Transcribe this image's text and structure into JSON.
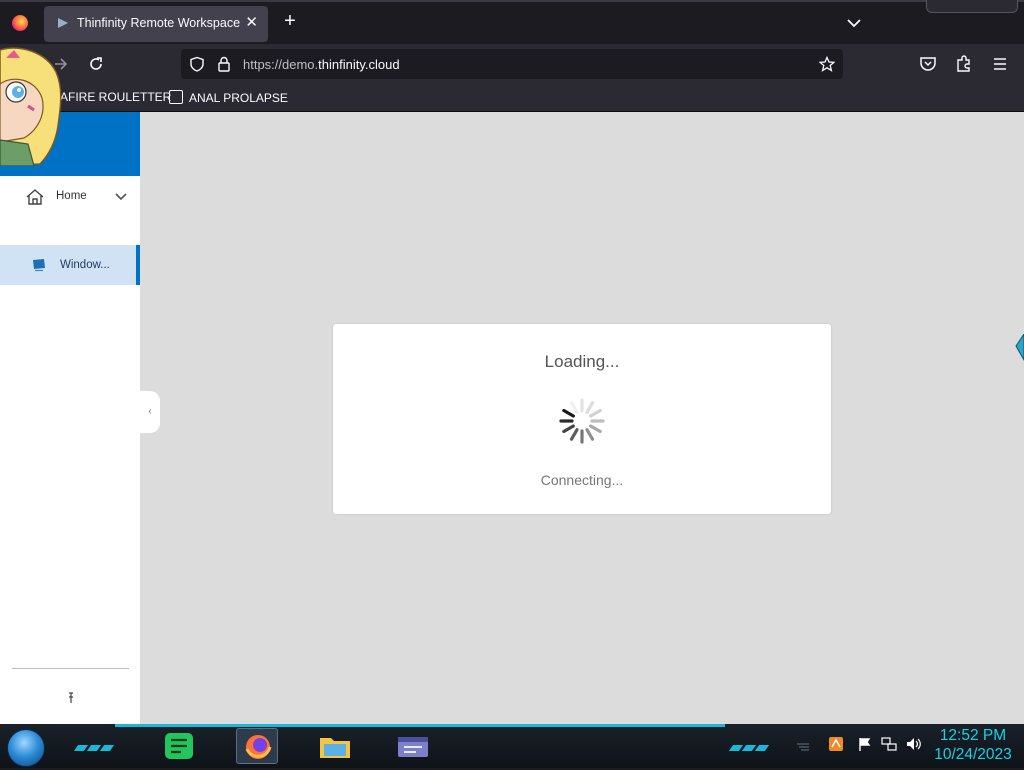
{
  "browser": {
    "tab": {
      "title": "Thinfinity Remote Workspace",
      "close_glyph": "✕"
    },
    "new_tab_glyph": "+",
    "url": {
      "prefix": "https://demo.",
      "domain": "thinfinity.cloud"
    },
    "bookmarks": [
      {
        "label": "DIAFIRE ROULETTER"
      },
      {
        "label": "ANAL PROLAPSE"
      }
    ]
  },
  "sidebar": {
    "items": [
      {
        "label": "Home"
      },
      {
        "label": "Window..."
      }
    ],
    "collapse_glyph": "‹"
  },
  "loading": {
    "title": "Loading...",
    "status": "Connecting..."
  },
  "taskbar": {
    "clock": {
      "time": "12:52 PM",
      "date": "10/24/2023"
    }
  },
  "colors": {
    "sidebar_header": "#0072c6",
    "selected_item": "#cfe3f5",
    "taskbar_accent": "#19b8d8",
    "clock": "#19d0e8"
  },
  "icons": [
    "firefox-logo-icon",
    "chevron-down-icon",
    "back-icon",
    "forward-icon",
    "reload-icon",
    "shield-icon",
    "lock-icon",
    "star-icon",
    "pocket-icon",
    "extensions-icon",
    "menu-icon",
    "home-icon",
    "monitor-icon",
    "spinner-icon",
    "pin-icon",
    "start-orb-icon",
    "notes-app-icon",
    "firefox-app-icon",
    "explorer-app-icon",
    "window-app-icon",
    "flag-icon",
    "network-icon",
    "volume-icon"
  ]
}
